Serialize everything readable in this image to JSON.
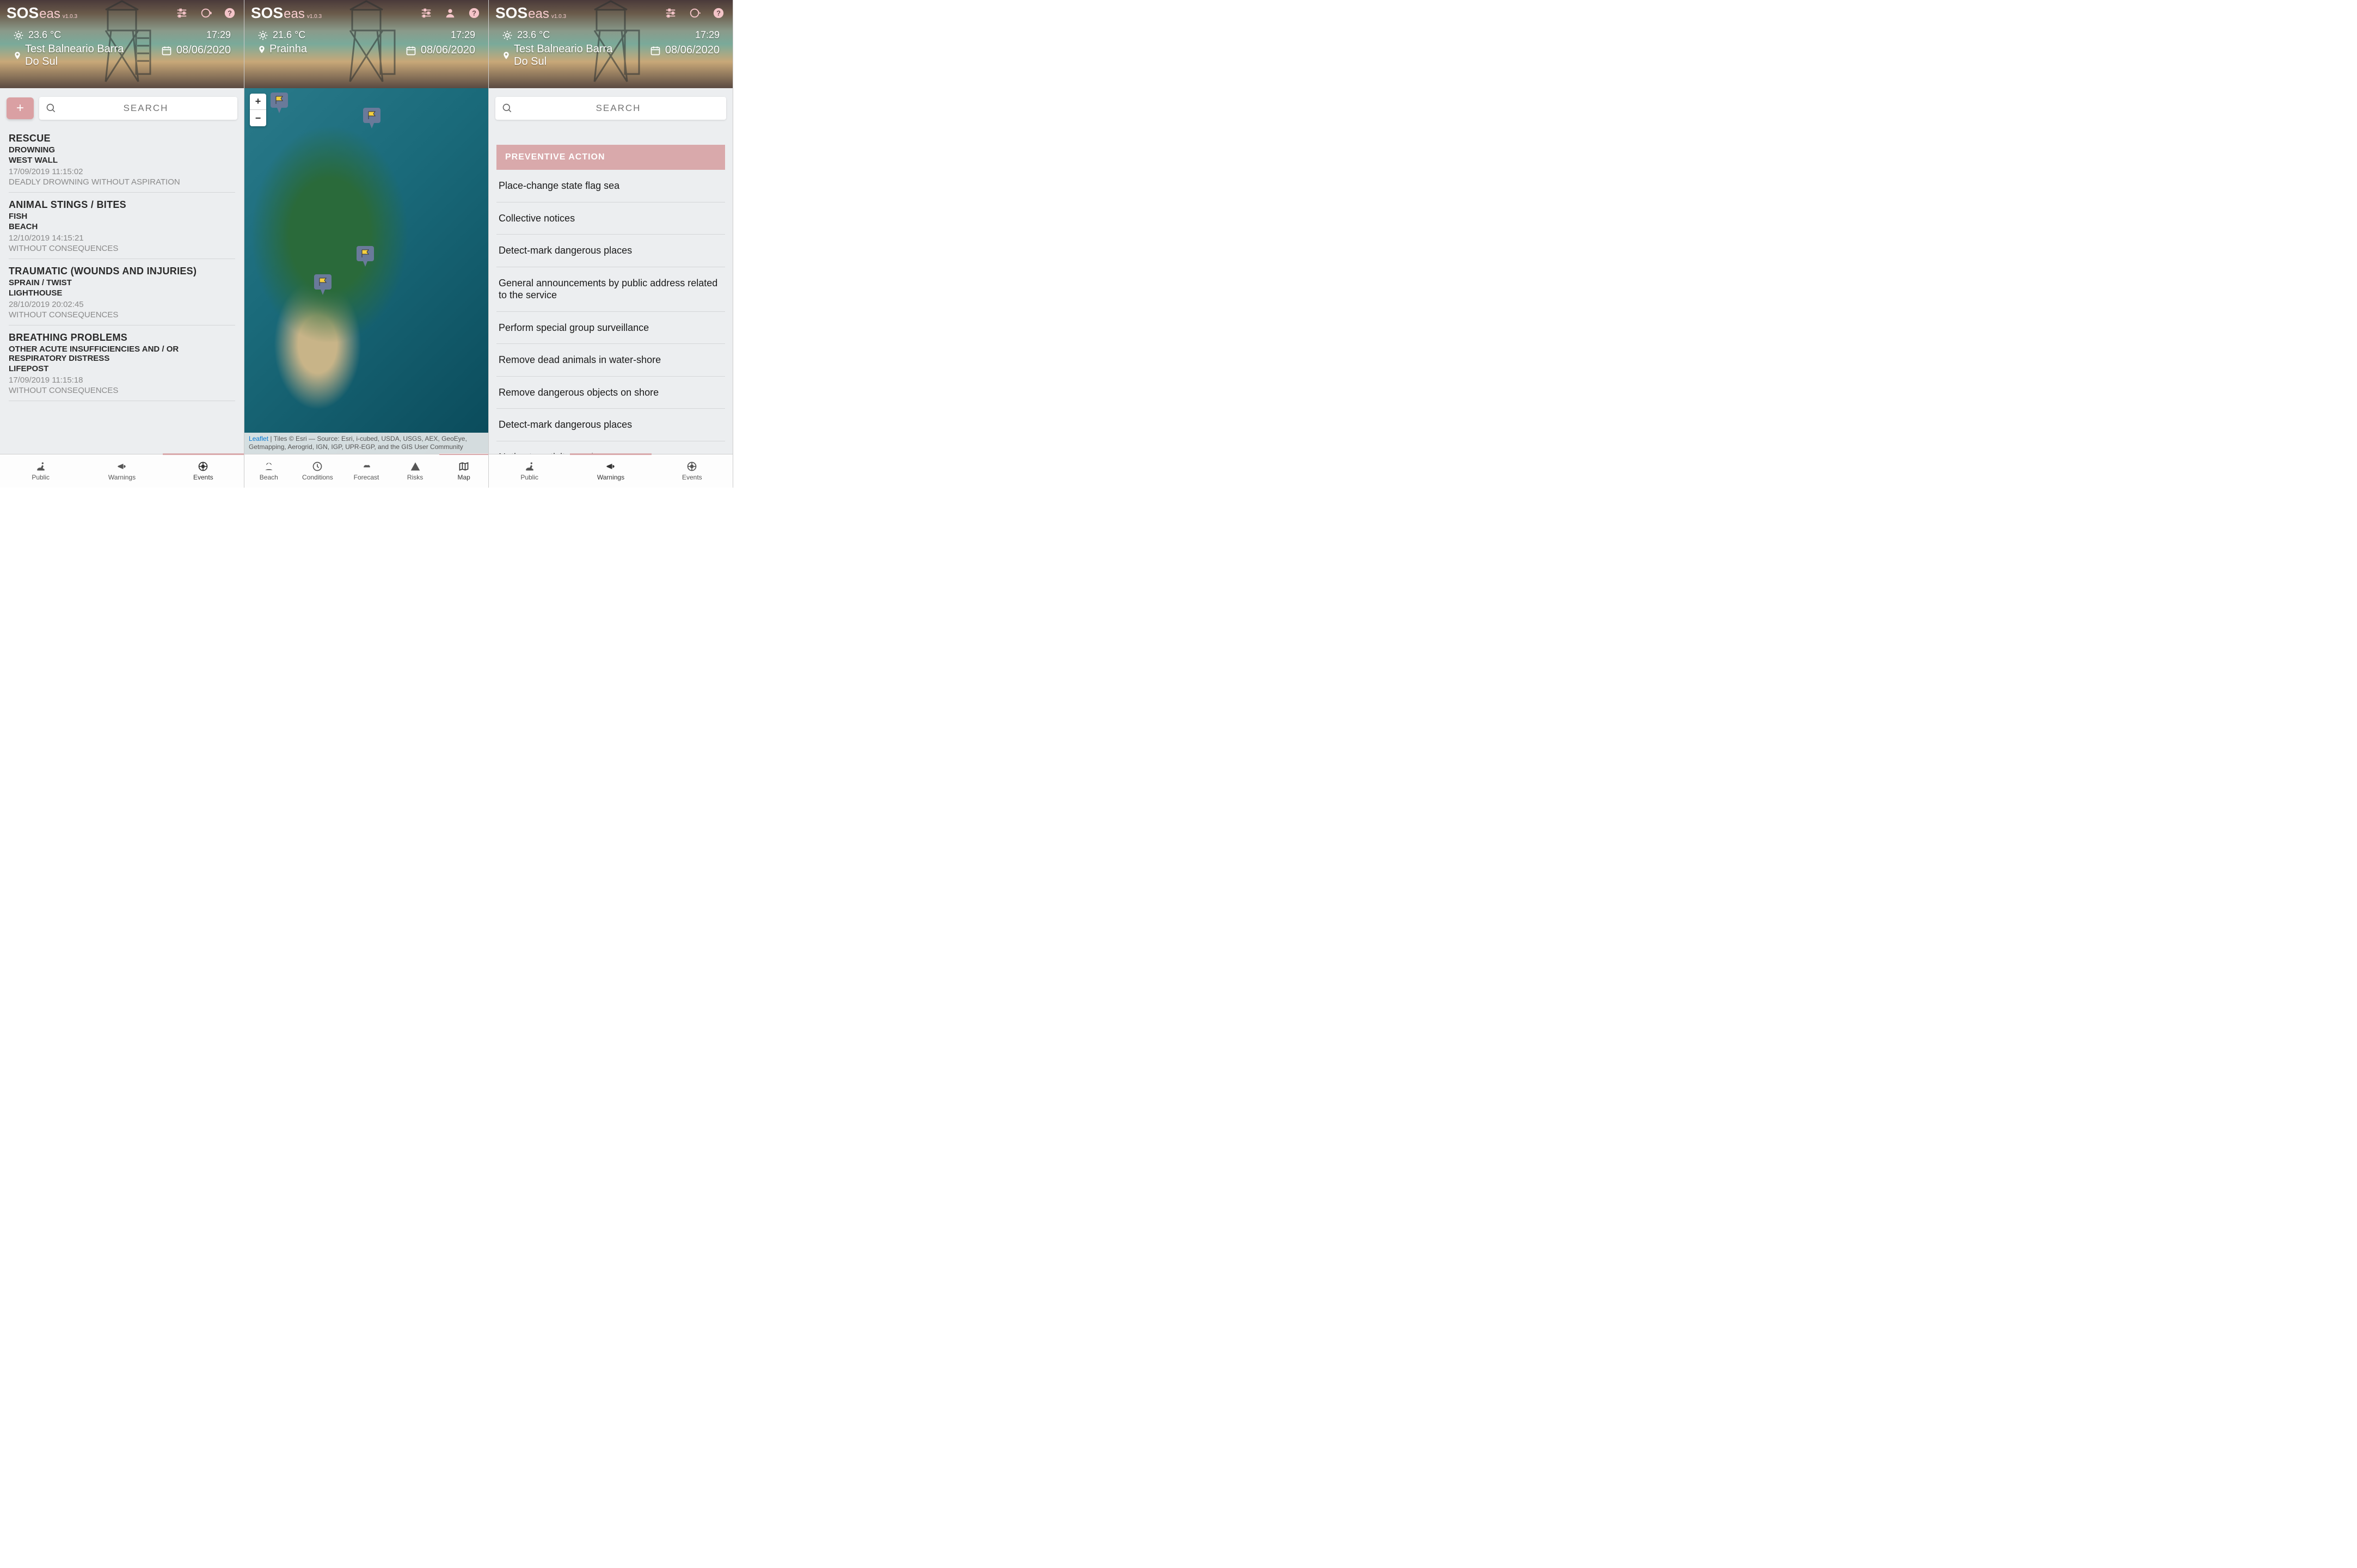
{
  "brand": {
    "part1": "SOS",
    "part2": "eas",
    "version": "v1.0.3"
  },
  "search": {
    "placeholder": "SEARCH"
  },
  "screen1": {
    "temp": "23.6 °C",
    "time": "17:29",
    "location": "Test Balneario Barra Do Sul",
    "date": "08/06/2020",
    "events": [
      {
        "title": "RESCUE",
        "sub1": "DROWNING",
        "sub2": "WEST WALL",
        "ts": "17/09/2019 11:15:02",
        "note": "DEADLY DROWNING WITHOUT ASPIRATION"
      },
      {
        "title": "ANIMAL STINGS / BITES",
        "sub1": "FISH",
        "sub2": "BEACH",
        "ts": "12/10/2019 14:15:21",
        "note": "WITHOUT CONSEQUENCES"
      },
      {
        "title": "TRAUMATIC (WOUNDS AND INJURIES)",
        "sub1": "SPRAIN / TWIST",
        "sub2": "LIGHTHOUSE",
        "ts": "28/10/2019 20:02:45",
        "note": "WITHOUT CONSEQUENCES"
      },
      {
        "title": "BREATHING PROBLEMS",
        "sub1": "OTHER ACUTE INSUFFICIENCIES AND / OR RESPIRATORY DISTRESS",
        "sub2": "LIFEPOST",
        "ts": "17/09/2019 11:15:18",
        "note": "WITHOUT CONSEQUENCES"
      }
    ],
    "nav": {
      "items": [
        "Public",
        "Warnings",
        "Events"
      ],
      "activeIndex": 2
    }
  },
  "screen2": {
    "temp": "21.6 °C",
    "time": "17:29",
    "location": "Prainha",
    "date": "08/06/2020",
    "attribution": {
      "link": "Leaflet",
      "text": " | Tiles © Esri — Source: Esri, i-cubed, USDA, USGS, AEX, GeoEye, Getmapping, Aerogrid, IGN, IGP, UPR-EGP, and the GIS User Community"
    },
    "nav": {
      "items": [
        "Beach",
        "Conditions",
        "Forecast",
        "Risks",
        "Map"
      ],
      "activeIndex": 4
    }
  },
  "screen3": {
    "temp": "23.6 °C",
    "time": "17:29",
    "location": "Test Balneario Barra Do Sul",
    "date": "08/06/2020",
    "section_title": "PREVENTIVE ACTION",
    "actions": [
      "Place-change state flag sea",
      "Collective notices",
      "Detect-mark dangerous places",
      "General announcements by public address related to the service",
      "Perform special group surveillance",
      "Remove dead animals in water-shore",
      "Remove dangerous objects on shore",
      "Detect-mark dangerous places",
      "Notice to activity teachers"
    ],
    "nav": {
      "items": [
        "Public",
        "Warnings",
        "Events"
      ],
      "activeIndex": 1
    }
  }
}
